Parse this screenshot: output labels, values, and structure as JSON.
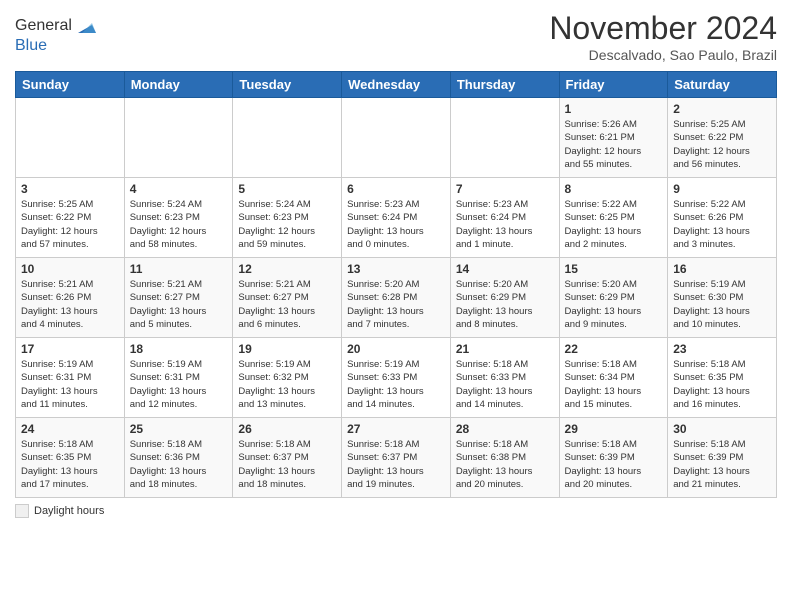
{
  "header": {
    "logo_line1": "General",
    "logo_line2": "Blue",
    "month_title": "November 2024",
    "location": "Descalvado, Sao Paulo, Brazil"
  },
  "days_of_week": [
    "Sunday",
    "Monday",
    "Tuesday",
    "Wednesday",
    "Thursday",
    "Friday",
    "Saturday"
  ],
  "weeks": [
    [
      {
        "day": "",
        "info": ""
      },
      {
        "day": "",
        "info": ""
      },
      {
        "day": "",
        "info": ""
      },
      {
        "day": "",
        "info": ""
      },
      {
        "day": "",
        "info": ""
      },
      {
        "day": "1",
        "info": "Sunrise: 5:26 AM\nSunset: 6:21 PM\nDaylight: 12 hours\nand 55 minutes."
      },
      {
        "day": "2",
        "info": "Sunrise: 5:25 AM\nSunset: 6:22 PM\nDaylight: 12 hours\nand 56 minutes."
      }
    ],
    [
      {
        "day": "3",
        "info": "Sunrise: 5:25 AM\nSunset: 6:22 PM\nDaylight: 12 hours\nand 57 minutes."
      },
      {
        "day": "4",
        "info": "Sunrise: 5:24 AM\nSunset: 6:23 PM\nDaylight: 12 hours\nand 58 minutes."
      },
      {
        "day": "5",
        "info": "Sunrise: 5:24 AM\nSunset: 6:23 PM\nDaylight: 12 hours\nand 59 minutes."
      },
      {
        "day": "6",
        "info": "Sunrise: 5:23 AM\nSunset: 6:24 PM\nDaylight: 13 hours\nand 0 minutes."
      },
      {
        "day": "7",
        "info": "Sunrise: 5:23 AM\nSunset: 6:24 PM\nDaylight: 13 hours\nand 1 minute."
      },
      {
        "day": "8",
        "info": "Sunrise: 5:22 AM\nSunset: 6:25 PM\nDaylight: 13 hours\nand 2 minutes."
      },
      {
        "day": "9",
        "info": "Sunrise: 5:22 AM\nSunset: 6:26 PM\nDaylight: 13 hours\nand 3 minutes."
      }
    ],
    [
      {
        "day": "10",
        "info": "Sunrise: 5:21 AM\nSunset: 6:26 PM\nDaylight: 13 hours\nand 4 minutes."
      },
      {
        "day": "11",
        "info": "Sunrise: 5:21 AM\nSunset: 6:27 PM\nDaylight: 13 hours\nand 5 minutes."
      },
      {
        "day": "12",
        "info": "Sunrise: 5:21 AM\nSunset: 6:27 PM\nDaylight: 13 hours\nand 6 minutes."
      },
      {
        "day": "13",
        "info": "Sunrise: 5:20 AM\nSunset: 6:28 PM\nDaylight: 13 hours\nand 7 minutes."
      },
      {
        "day": "14",
        "info": "Sunrise: 5:20 AM\nSunset: 6:29 PM\nDaylight: 13 hours\nand 8 minutes."
      },
      {
        "day": "15",
        "info": "Sunrise: 5:20 AM\nSunset: 6:29 PM\nDaylight: 13 hours\nand 9 minutes."
      },
      {
        "day": "16",
        "info": "Sunrise: 5:19 AM\nSunset: 6:30 PM\nDaylight: 13 hours\nand 10 minutes."
      }
    ],
    [
      {
        "day": "17",
        "info": "Sunrise: 5:19 AM\nSunset: 6:31 PM\nDaylight: 13 hours\nand 11 minutes."
      },
      {
        "day": "18",
        "info": "Sunrise: 5:19 AM\nSunset: 6:31 PM\nDaylight: 13 hours\nand 12 minutes."
      },
      {
        "day": "19",
        "info": "Sunrise: 5:19 AM\nSunset: 6:32 PM\nDaylight: 13 hours\nand 13 minutes."
      },
      {
        "day": "20",
        "info": "Sunrise: 5:19 AM\nSunset: 6:33 PM\nDaylight: 13 hours\nand 14 minutes."
      },
      {
        "day": "21",
        "info": "Sunrise: 5:18 AM\nSunset: 6:33 PM\nDaylight: 13 hours\nand 14 minutes."
      },
      {
        "day": "22",
        "info": "Sunrise: 5:18 AM\nSunset: 6:34 PM\nDaylight: 13 hours\nand 15 minutes."
      },
      {
        "day": "23",
        "info": "Sunrise: 5:18 AM\nSunset: 6:35 PM\nDaylight: 13 hours\nand 16 minutes."
      }
    ],
    [
      {
        "day": "24",
        "info": "Sunrise: 5:18 AM\nSunset: 6:35 PM\nDaylight: 13 hours\nand 17 minutes."
      },
      {
        "day": "25",
        "info": "Sunrise: 5:18 AM\nSunset: 6:36 PM\nDaylight: 13 hours\nand 18 minutes."
      },
      {
        "day": "26",
        "info": "Sunrise: 5:18 AM\nSunset: 6:37 PM\nDaylight: 13 hours\nand 18 minutes."
      },
      {
        "day": "27",
        "info": "Sunrise: 5:18 AM\nSunset: 6:37 PM\nDaylight: 13 hours\nand 19 minutes."
      },
      {
        "day": "28",
        "info": "Sunrise: 5:18 AM\nSunset: 6:38 PM\nDaylight: 13 hours\nand 20 minutes."
      },
      {
        "day": "29",
        "info": "Sunrise: 5:18 AM\nSunset: 6:39 PM\nDaylight: 13 hours\nand 20 minutes."
      },
      {
        "day": "30",
        "info": "Sunrise: 5:18 AM\nSunset: 6:39 PM\nDaylight: 13 hours\nand 21 minutes."
      }
    ]
  ],
  "footer": {
    "legend_label": "Daylight hours"
  }
}
